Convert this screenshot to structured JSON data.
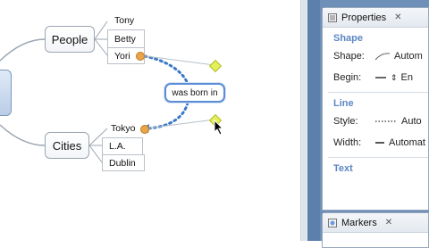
{
  "mindmap": {
    "topics": {
      "people": "People",
      "cities": "Cities"
    },
    "people_children": [
      "Tony",
      "Betty",
      "Yori"
    ],
    "cities_children": [
      "Tokyo",
      "L.A.",
      "Dublin"
    ],
    "relationship_label": "was born in"
  },
  "properties_panel": {
    "tab_title": "Properties",
    "sections": {
      "shape": "Shape",
      "line": "Line",
      "text": "Text"
    },
    "shape_label": "Shape:",
    "shape_value": "Autom",
    "begin_label": "Begin:",
    "begin_value": "En",
    "style_label": "Style:",
    "style_value": "Auto",
    "width_label": "Width:",
    "width_value": "Automat"
  },
  "markers_panel": {
    "tab_title": "Markers"
  }
}
